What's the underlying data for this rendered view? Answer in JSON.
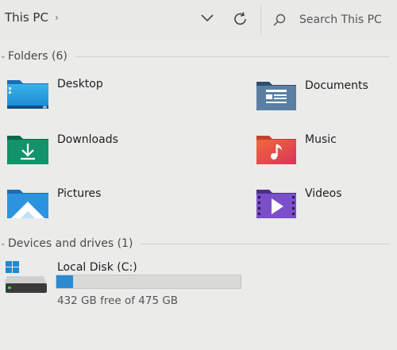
{
  "header": {
    "breadcrumb": "This PC",
    "search_placeholder": "Search This PC"
  },
  "folders_section": {
    "title": "Folders (6)",
    "items": [
      {
        "label": "Desktop",
        "icon": "desktop-folder-icon"
      },
      {
        "label": "Documents",
        "icon": "documents-folder-icon"
      },
      {
        "label": "Downloads",
        "icon": "downloads-folder-icon"
      },
      {
        "label": "Music",
        "icon": "music-folder-icon"
      },
      {
        "label": "Pictures",
        "icon": "pictures-folder-icon"
      },
      {
        "label": "Videos",
        "icon": "videos-folder-icon"
      }
    ]
  },
  "drives_section": {
    "title": "Devices and drives (1)",
    "drives": [
      {
        "label": "Local Disk (C:)",
        "free_text": "432 GB free of 475 GB",
        "used_fraction": 0.09
      }
    ]
  },
  "colors": {
    "accent": "#2b8bd3",
    "background": "#ebebea"
  }
}
